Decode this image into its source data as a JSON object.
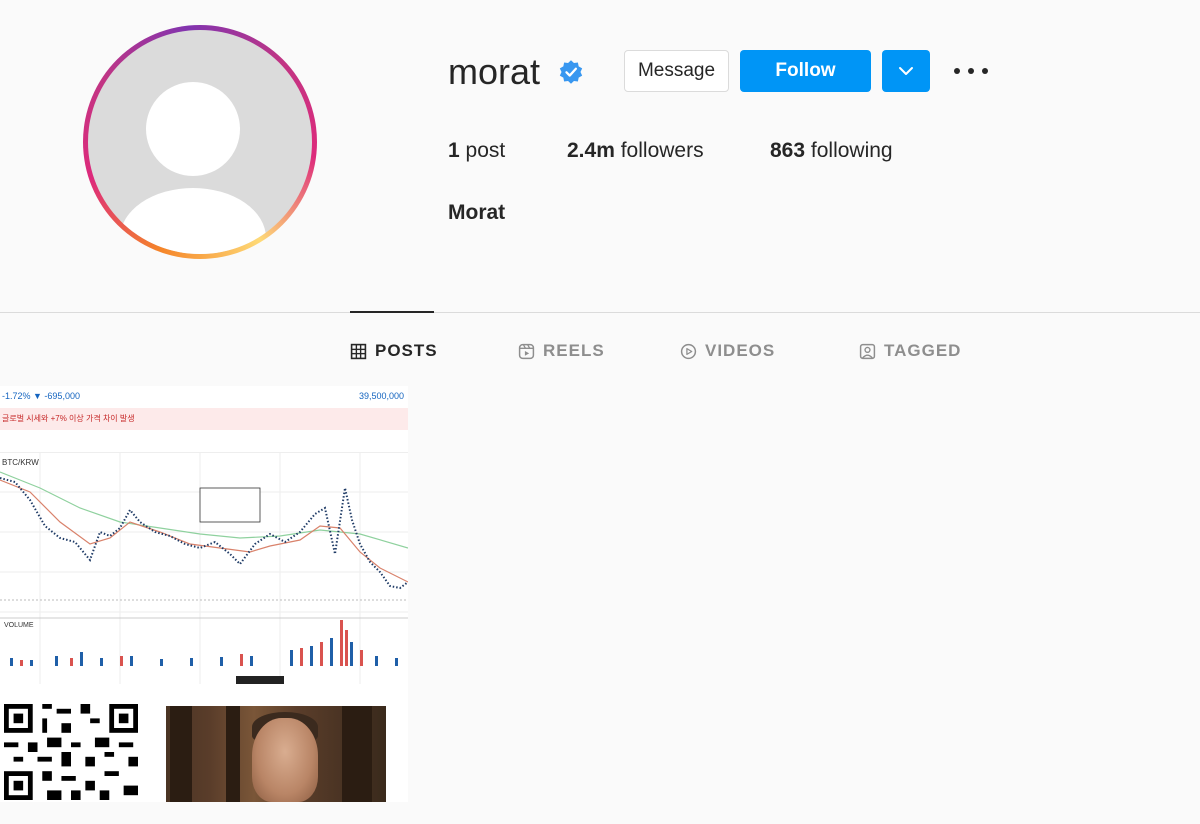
{
  "profile": {
    "username": "morat",
    "verified": true,
    "full_name": "Morat",
    "avatar": "default-avatar-placeholder"
  },
  "actions": {
    "message_label": "Message",
    "follow_label": "Follow",
    "dropdown_icon": "chevron-down-icon",
    "more_icon": "more-options-icon"
  },
  "stats": {
    "posts_count": "1",
    "posts_label": "post",
    "followers_count": "2.4m",
    "followers_label": "followers",
    "following_count": "863",
    "following_label": "following"
  },
  "tabs": [
    {
      "label": "POSTS",
      "icon": "grid-icon",
      "active": true
    },
    {
      "label": "REELS",
      "icon": "reels-icon",
      "active": false
    },
    {
      "label": "VIDEOS",
      "icon": "play-icon",
      "active": false
    },
    {
      "label": "TAGGED",
      "icon": "tagged-icon",
      "active": false
    }
  ],
  "post": {
    "chart_price_change": "-1.72% ▼ -695,000",
    "chart_price_right": "39,500,000",
    "chart_pair": "BTC/KRW",
    "chart_volume_label": "VOLUME",
    "chart_alert_text": "글로벌 시세와 +7% 이상 가격 차이 발생"
  },
  "colors": {
    "accent": "#0095f6",
    "verified": "#3897f0",
    "text_primary": "#262626",
    "text_secondary": "#8e8e8e"
  }
}
